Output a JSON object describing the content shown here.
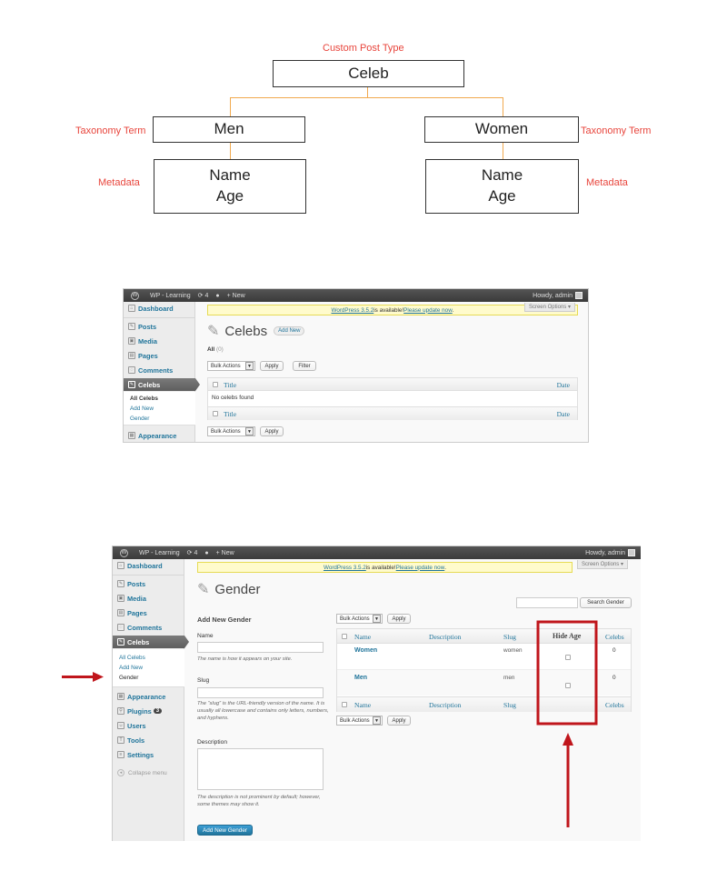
{
  "diagram": {
    "root_label": "Custom Post Type",
    "root": "Celeb",
    "left_term_label": "Taxonomy Term",
    "left_term": "Men",
    "right_term_label": "Taxonomy Term",
    "right_term": "Women",
    "left_meta_label": "Metadata",
    "right_meta_label": "Metadata",
    "meta_line1": "Name",
    "meta_line2": "Age"
  },
  "shot1": {
    "adminbar": {
      "site": "WP - Learning",
      "updates": "4",
      "new": "New",
      "howdy": "Howdy, admin"
    },
    "notice": {
      "pre": "WordPress 3.5.2",
      "mid": " is available! ",
      "link": "Please update now",
      "post": "."
    },
    "screen_options": "Screen Options ▾",
    "menu": {
      "dashboard": "Dashboard",
      "posts": "Posts",
      "media": "Media",
      "pages": "Pages",
      "comments": "Comments",
      "celebs": "Celebs",
      "appearance": "Appearance"
    },
    "submenu": [
      "All Celebs",
      "Add New",
      "Gender"
    ],
    "title": "Celebs",
    "add_new": "Add New",
    "filter_all": "All",
    "filter_count": "(0)",
    "bulk_actions": "Bulk Actions",
    "apply": "Apply",
    "filter": "Filter",
    "col_title": "Title",
    "col_date": "Date",
    "empty": "No celebs found"
  },
  "shot2": {
    "adminbar": {
      "site": "WP - Learning",
      "updates": "4",
      "new": "New",
      "howdy": "Howdy, admin"
    },
    "notice": {
      "pre": "WordPress 3.5.2",
      "mid": " is available! ",
      "link": "Please update now",
      "post": "."
    },
    "screen_options": "Screen Options ▾",
    "menu": {
      "dashboard": "Dashboard",
      "posts": "Posts",
      "media": "Media",
      "pages": "Pages",
      "comments": "Comments",
      "celebs": "Celebs",
      "appearance": "Appearance",
      "plugins": "Plugins",
      "plugins_badge": "3",
      "users": "Users",
      "tools": "Tools",
      "settings": "Settings",
      "collapse": "Collapse menu"
    },
    "submenu": [
      "All Celebs",
      "Add New",
      "Gender"
    ],
    "title": "Gender",
    "search_button": "Search Gender",
    "form": {
      "heading": "Add New Gender",
      "name_label": "Name",
      "name_desc": "The name is how it appears on your site.",
      "slug_label": "Slug",
      "slug_desc": "The “slug” is the URL-friendly version of the name. It is usually all lowercase and contains only letters, numbers, and hyphens.",
      "desc_label": "Description",
      "desc_desc": "The description is not prominent by default; however, some themes may show it.",
      "submit": "Add New Gender"
    },
    "bulk_actions": "Bulk Actions",
    "apply": "Apply",
    "columns": [
      "Name",
      "Description",
      "Slug",
      "Hide Age",
      "Celebs"
    ],
    "rows": [
      {
        "name": "Women",
        "slug": "women",
        "count": "0"
      },
      {
        "name": "Men",
        "slug": "men",
        "count": "0"
      }
    ],
    "highlight_color": "#c0161c"
  }
}
